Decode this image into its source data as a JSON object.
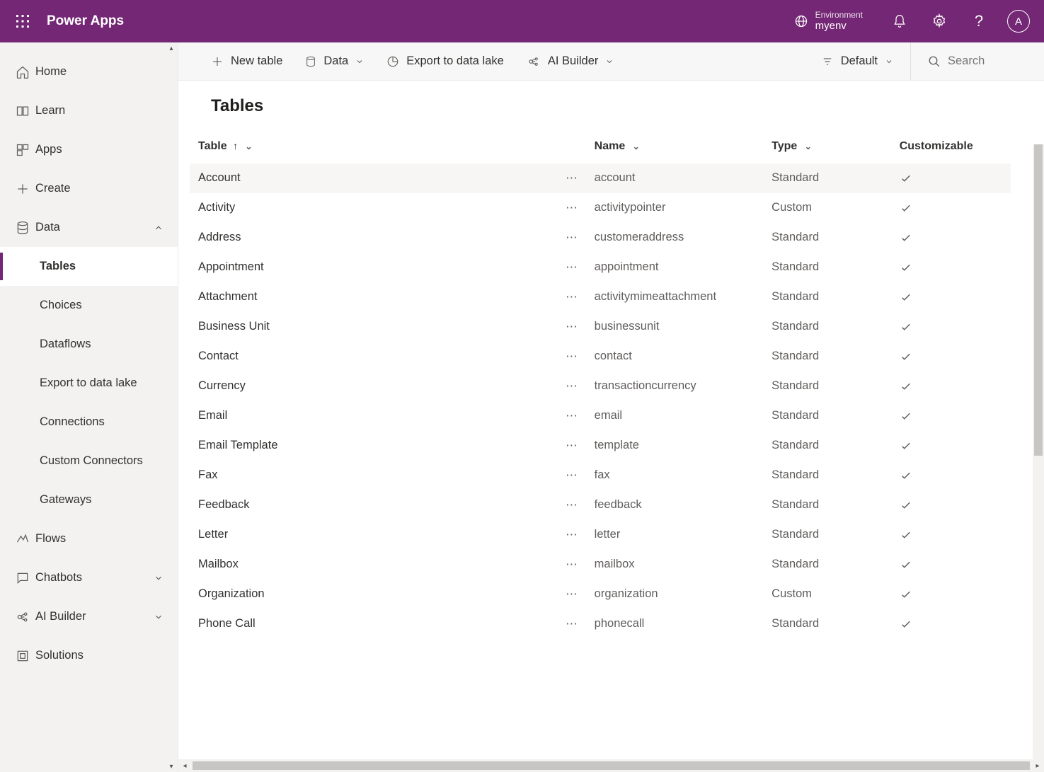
{
  "header": {
    "app_title": "Power Apps",
    "env_label": "Environment",
    "env_name": "myenv",
    "avatar_letter": "A"
  },
  "sidebar": {
    "items": [
      {
        "label": "Home",
        "icon": "home"
      },
      {
        "label": "Learn",
        "icon": "book"
      },
      {
        "label": "Apps",
        "icon": "apps"
      },
      {
        "label": "Create",
        "icon": "plus"
      },
      {
        "label": "Data",
        "icon": "data",
        "expanded": true
      },
      {
        "label": "Tables",
        "child": true,
        "active": true
      },
      {
        "label": "Choices",
        "child": true
      },
      {
        "label": "Dataflows",
        "child": true
      },
      {
        "label": "Export to data lake",
        "child": true
      },
      {
        "label": "Connections",
        "child": true
      },
      {
        "label": "Custom Connectors",
        "child": true
      },
      {
        "label": "Gateways",
        "child": true
      },
      {
        "label": "Flows",
        "icon": "flow"
      },
      {
        "label": "Chatbots",
        "icon": "chat",
        "chevron": true
      },
      {
        "label": "AI Builder",
        "icon": "ai",
        "chevron": true
      },
      {
        "label": "Solutions",
        "icon": "solution"
      }
    ]
  },
  "commandbar": {
    "new_table": "New table",
    "data": "Data",
    "export": "Export to data lake",
    "ai_builder": "AI Builder",
    "view": "Default",
    "search_placeholder": "Search"
  },
  "page": {
    "title": "Tables"
  },
  "table": {
    "columns": {
      "table": "Table",
      "name": "Name",
      "type": "Type",
      "customizable": "Customizable"
    },
    "rows": [
      {
        "table": "Account",
        "name": "account",
        "type": "Standard",
        "highlight": true
      },
      {
        "table": "Activity",
        "name": "activitypointer",
        "type": "Custom"
      },
      {
        "table": "Address",
        "name": "customeraddress",
        "type": "Standard"
      },
      {
        "table": "Appointment",
        "name": "appointment",
        "type": "Standard"
      },
      {
        "table": "Attachment",
        "name": "activitymimeattachment",
        "type": "Standard"
      },
      {
        "table": "Business Unit",
        "name": "businessunit",
        "type": "Standard"
      },
      {
        "table": "Contact",
        "name": "contact",
        "type": "Standard"
      },
      {
        "table": "Currency",
        "name": "transactioncurrency",
        "type": "Standard"
      },
      {
        "table": "Email",
        "name": "email",
        "type": "Standard"
      },
      {
        "table": "Email Template",
        "name": "template",
        "type": "Standard"
      },
      {
        "table": "Fax",
        "name": "fax",
        "type": "Standard"
      },
      {
        "table": "Feedback",
        "name": "feedback",
        "type": "Standard"
      },
      {
        "table": "Letter",
        "name": "letter",
        "type": "Standard"
      },
      {
        "table": "Mailbox",
        "name": "mailbox",
        "type": "Standard"
      },
      {
        "table": "Organization",
        "name": "organization",
        "type": "Custom"
      },
      {
        "table": "Phone Call",
        "name": "phonecall",
        "type": "Standard"
      }
    ]
  }
}
